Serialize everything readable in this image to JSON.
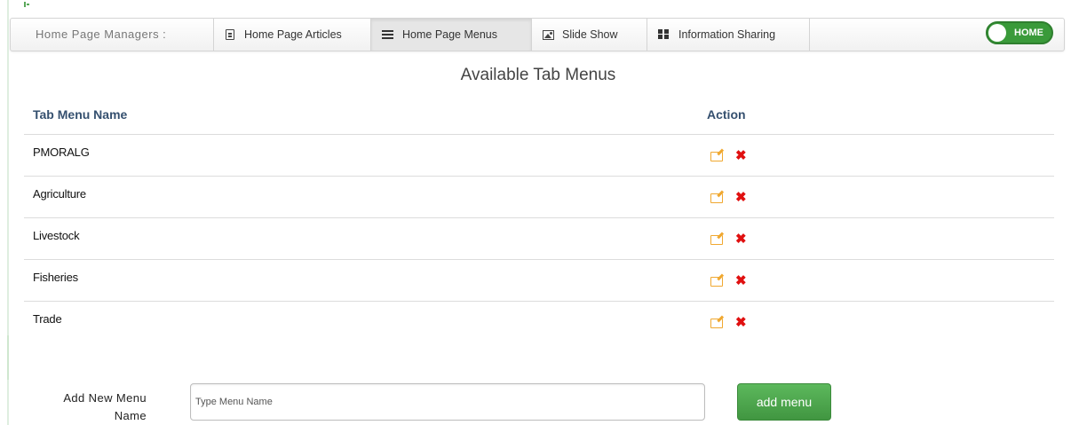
{
  "navbar": {
    "brand": "Home Page Managers :",
    "tabs": [
      {
        "label": "Home Page Articles",
        "icon": "file-icon",
        "active": false
      },
      {
        "label": "Home Page Menus",
        "icon": "list-icon",
        "active": true
      },
      {
        "label": "Slide Show",
        "icon": "image-icon",
        "active": false
      },
      {
        "label": "Information Sharing",
        "icon": "grid-icon",
        "active": false
      }
    ],
    "home_toggle": "HOME"
  },
  "main": {
    "title": "Available Tab Menus",
    "table": {
      "columns": [
        "Tab Menu Name",
        "Action"
      ],
      "rows": [
        {
          "name": "PMORALG"
        },
        {
          "name": "Agriculture"
        },
        {
          "name": "Livestock"
        },
        {
          "name": "Fisheries"
        },
        {
          "name": "Trade"
        }
      ],
      "delete_glyph": "✖"
    }
  },
  "add_form": {
    "label": "Add New Menu Name",
    "placeholder": "Type Menu Name",
    "button": "add menu"
  },
  "colors": {
    "accent_green": "#5cb85c",
    "header_text": "#35506f",
    "edit_icon": "#f0a830",
    "delete_icon": "#e01010"
  }
}
